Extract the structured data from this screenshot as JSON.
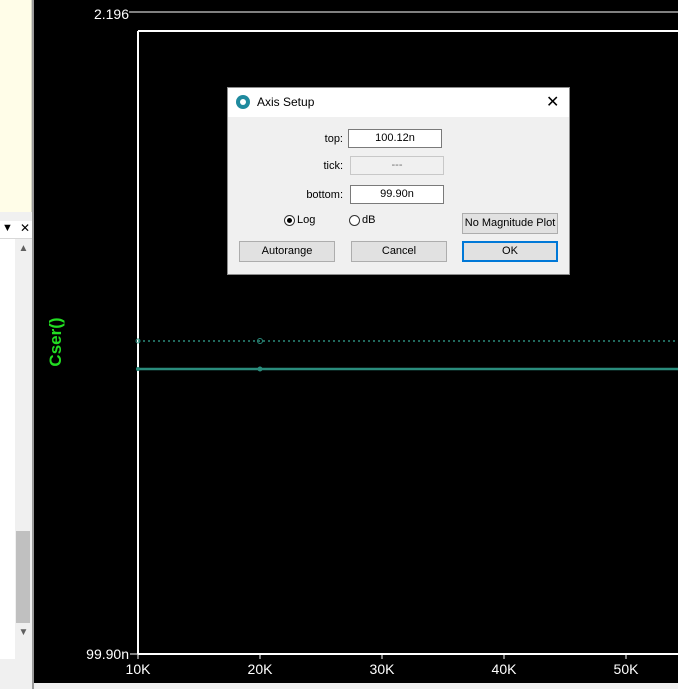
{
  "plot": {
    "y_axis_top": "2.196",
    "y_axis_bottom": "99.90n",
    "trace_label": "Cser()",
    "x_ticks": [
      "10K",
      "20K",
      "30K",
      "40K",
      "50K"
    ],
    "trace_color": "#22dd22",
    "curve_color": "#2a8c7c"
  },
  "dialog": {
    "title": "Axis Setup",
    "close_symbol": "✕",
    "top_label": "top:",
    "top_value": "100.12n",
    "tick_label": "tick:",
    "tick_value": "---",
    "bottom_label": "bottom:",
    "bottom_value": "99.90n",
    "log_label": "Log",
    "log_checked": true,
    "db_label": "dB",
    "db_checked": false,
    "no_magnitude_label": "No Magnitude Plot",
    "autorange_label": "Autorange",
    "cancel_label": "Cancel",
    "ok_label": "OK"
  },
  "left_panel": {
    "dropdown_symbol": "▼",
    "close_symbol": "✕",
    "scroll_up": "▲",
    "scroll_down": "▼"
  }
}
